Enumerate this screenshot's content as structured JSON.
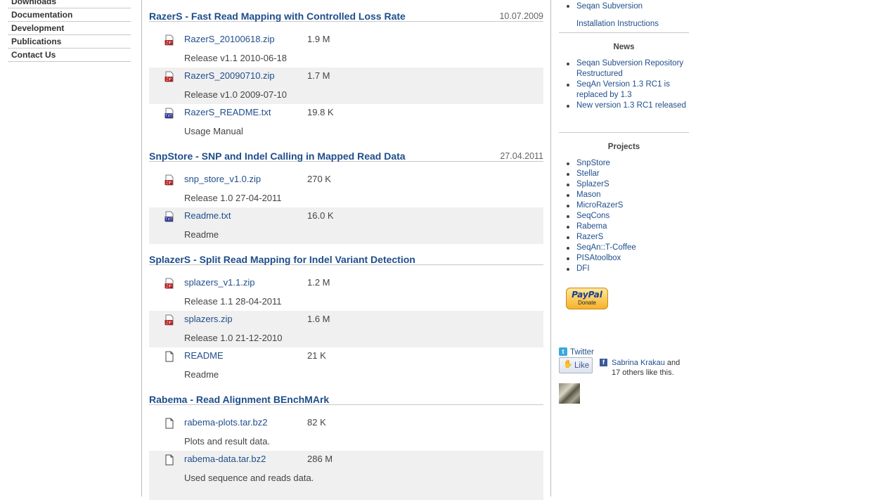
{
  "nav": {
    "items": [
      {
        "label": "Downloads"
      },
      {
        "label": "Documentation"
      },
      {
        "label": "Development"
      },
      {
        "label": "Publications"
      },
      {
        "label": "Contact Us"
      }
    ]
  },
  "sections": [
    {
      "title": "RazerS - Fast Read Mapping with Controlled Loss Rate",
      "date": "10.07.2009",
      "files": [
        {
          "name": "RazerS_20100618.zip",
          "size": "1.9 M",
          "desc": "Release v1.1 2010-06-18",
          "icon": "zip-icon"
        },
        {
          "name": "RazerS_20090710.zip",
          "size": "1.7 M",
          "desc": "Release v1.0 2009-07-10",
          "icon": "zip-icon"
        },
        {
          "name": "RazerS_README.txt",
          "size": "19.8 K",
          "desc": "Usage Manual",
          "icon": "txt-icon"
        }
      ]
    },
    {
      "title": "SnpStore - SNP and Indel Calling in Mapped Read Data",
      "date": "27.04.2011",
      "files": [
        {
          "name": "snp_store_v1.0.zip",
          "size": "270 K",
          "desc": "Release 1.0 27-04-2011",
          "icon": "zip-icon"
        },
        {
          "name": "Readme.txt",
          "size": "16.0 K",
          "desc": "Readme",
          "icon": "txt-icon"
        }
      ]
    },
    {
      "title": "SplazerS - Split Read Mapping for Indel Variant Detection",
      "date": "",
      "files": [
        {
          "name": "splazers_v1.1.zip",
          "size": "1.2 M",
          "desc": "Release 1.1 28-04-2011",
          "icon": "zip-icon"
        },
        {
          "name": "splazers.zip",
          "size": "1.6 M",
          "desc": "Release 1.0 21-12-2010",
          "icon": "zip-icon"
        },
        {
          "name": "README",
          "size": "21 K",
          "desc": "Readme",
          "icon": "file-icon"
        }
      ]
    },
    {
      "title": "Rabema - Read Alignment BEnchMArk",
      "date": "",
      "files": [
        {
          "name": "rabema-plots.tar.bz2",
          "size": "82 K",
          "desc": "Plots and result data.",
          "icon": "file-icon"
        },
        {
          "name": "rabema-data.tar.bz2",
          "size": "286 M",
          "desc": "Used sequence and reads data.",
          "icon": "file-icon"
        }
      ]
    }
  ],
  "sidebar": {
    "top_links": [
      {
        "label": "Seqan Subversion",
        "bullet": true
      },
      {
        "label": "Installation Instructions",
        "bullet": false
      }
    ],
    "news_heading": "News",
    "news": [
      {
        "label": "Seqan Subversion Repository Restructured"
      },
      {
        "label": "SeqAn Version 1.3 RC1 is replaced by 1.3"
      },
      {
        "label": "New version 1.3 RC1 released"
      }
    ],
    "projects_heading": "Projects",
    "projects": [
      {
        "label": "SnpStore"
      },
      {
        "label": "Stellar"
      },
      {
        "label": "SplazerS"
      },
      {
        "label": "Mason"
      },
      {
        "label": "MicroRazerS"
      },
      {
        "label": "SeqCons"
      },
      {
        "label": "Rabema"
      },
      {
        "label": "RazerS"
      },
      {
        "label": "SeqAn::T-Coffee"
      },
      {
        "label": "PISAtoolbox"
      },
      {
        "label": "DFI"
      }
    ],
    "paypal": {
      "brand": "PayPal",
      "label": "Donate"
    },
    "twitter_label": "Twitter",
    "like_label": "Like",
    "fb_person": "Sabrina Krakau",
    "fb_text_1": " and",
    "fb_text_2": "17 others like this."
  },
  "colors": {
    "link": "#1f4e8c",
    "row_alt": "#f0f0f0",
    "rule": "#c8c8c8",
    "zip_icon": "#b01818",
    "txt_icon": "#2a2f8c"
  }
}
